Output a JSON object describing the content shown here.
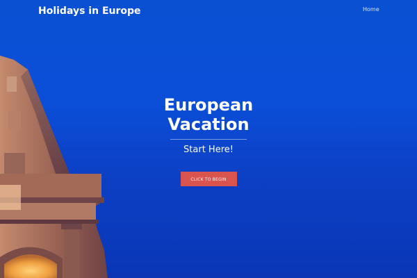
{
  "header": {
    "site_title": "Holidays in Europe",
    "nav_home": "Home"
  },
  "hero": {
    "heading_line1": "European",
    "heading_line2": "Vacation",
    "subtitle": "Start Here!",
    "button_label": "Click to Begin"
  },
  "colors": {
    "sky_blue": "#0b4fd9",
    "button_red": "#d9534f",
    "stone": "#8a5a4e"
  }
}
